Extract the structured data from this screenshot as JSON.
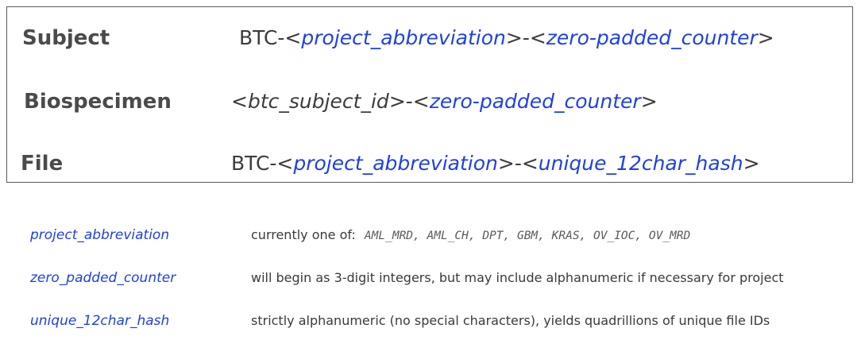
{
  "id_formats": [
    {
      "label": "Subject",
      "pattern": [
        {
          "text": "BTC-<",
          "kind": "plain"
        },
        {
          "text": "project_abbreviation",
          "kind": "var"
        },
        {
          "text": ">-<",
          "kind": "plain"
        },
        {
          "text": "zero-padded_counter",
          "kind": "var"
        },
        {
          "text": ">",
          "kind": "plain"
        }
      ]
    },
    {
      "label": "Biospecimen",
      "pattern": [
        {
          "text": "<",
          "kind": "plain"
        },
        {
          "text": "btc_subject_id",
          "kind": "var-plain"
        },
        {
          "text": ">-<",
          "kind": "plain"
        },
        {
          "text": "zero-padded_counter",
          "kind": "var"
        },
        {
          "text": ">",
          "kind": "plain"
        }
      ]
    },
    {
      "label": "File",
      "pattern": [
        {
          "text": "BTC-<",
          "kind": "plain"
        },
        {
          "text": "project_abbreviation",
          "kind": "var"
        },
        {
          "text": ">-<",
          "kind": "plain"
        },
        {
          "text": "unique_12char_hash",
          "kind": "var"
        },
        {
          "text": ">",
          "kind": "plain"
        }
      ]
    }
  ],
  "definitions": [
    {
      "term": "project_abbreviation",
      "description": "currently one of:",
      "values": "AML_MRD, AML_CH, DPT, GBM, KRAS, OV_IOC, OV_MRD"
    },
    {
      "term": "zero_padded_counter",
      "description": "will begin as 3-digit integers, but may include alphanumeric if necessary for project"
    },
    {
      "term": "unique_12char_hash",
      "description": "strictly alphanumeric (no special characters), yields quadrillions of unique file IDs"
    }
  ],
  "colors": {
    "variable": "#1f3fe6",
    "text": "#3c3c3c",
    "border": "#5a5a5a"
  }
}
